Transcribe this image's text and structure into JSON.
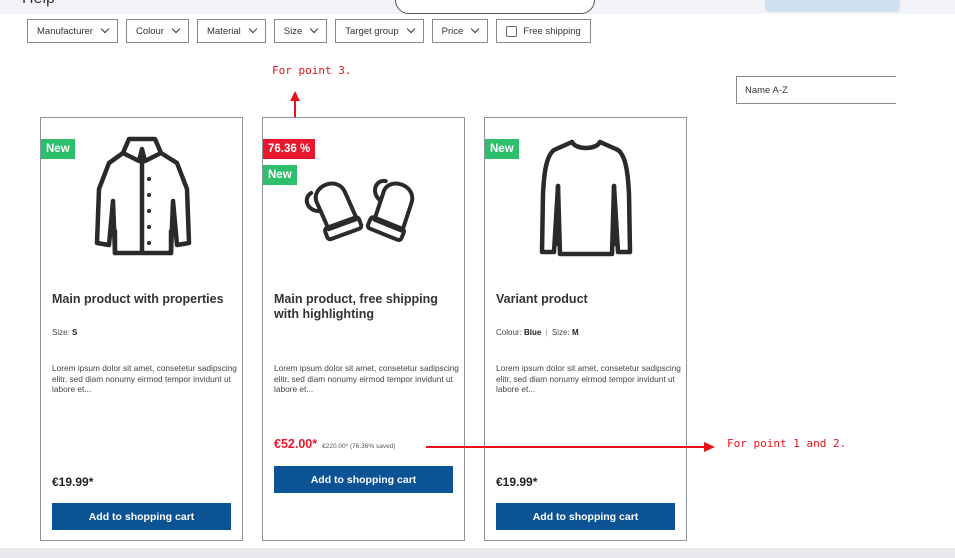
{
  "header": {
    "help_label": "Help"
  },
  "filters": [
    {
      "label": "Manufacturer"
    },
    {
      "label": "Colour"
    },
    {
      "label": "Material"
    },
    {
      "label": "Size"
    },
    {
      "label": "Target group"
    },
    {
      "label": "Price"
    }
  ],
  "free_shipping_label": "Free shipping",
  "sort": {
    "value": "Name A-Z"
  },
  "annotations": {
    "point3": "For point 3.",
    "point12": "For point 1 and 2.",
    "color": "#e8101a"
  },
  "colors": {
    "new_badge": "#2dbf6c",
    "discount_badge": "#e8172d",
    "cart_button": "#0c5396"
  },
  "products": [
    {
      "image_icon": "jacket-icon",
      "badge_new": "New",
      "title": "Main product with properties",
      "props": {
        "label1": "Size:",
        "value1": "S"
      },
      "description": "Lorem ipsum dolor sit amet, consetetur sadipscing elitr, sed diam nonumy eirmod tempor invidunt ut labore et...",
      "price": "€19.99*",
      "cart_label": "Add to shopping cart"
    },
    {
      "image_icon": "mittens-icon",
      "badge_discount": "76.36 %",
      "badge_new": "New",
      "title": "Main product, free shipping with highlighting",
      "description": "Lorem ipsum dolor sit amet, consetetur sadipscing elitr, sed diam nonumy eirmod tempor invidunt ut labore et...",
      "price": "€52.00*",
      "old_price": "€220.00* (76.36% saved)",
      "cart_label": "Add to shopping cart"
    },
    {
      "image_icon": "sweater-icon",
      "badge_new": "New",
      "title": "Variant product",
      "props": {
        "label1": "Colour:",
        "value1": "Blue",
        "separator": "|",
        "label2": "Size:",
        "value2": "M"
      },
      "description": "Lorem ipsum dolor sit amet, consetetur sadipscing elitr, sed diam nonumy eirmod tempor invidunt ut labore et...",
      "price": "€19.99*",
      "cart_label": "Add to shopping cart"
    }
  ]
}
